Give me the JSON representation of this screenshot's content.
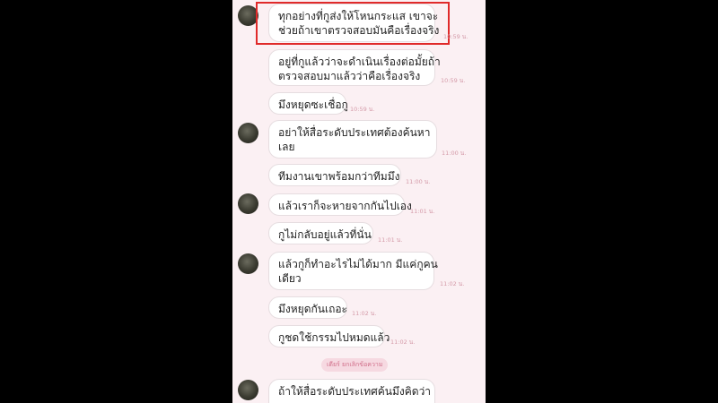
{
  "messages": [
    {
      "lines": [
        "ทุกอย่างที่กูส่งให้โหนกระแส เขาจะ",
        "ช่วยถ้าเขาตรวจสอบมันคือเรื่องจริง"
      ],
      "time": "10:59 น."
    },
    {
      "lines": [
        "อยู่ที่กูแล้วว่าจะดำเนินเรื่องต่อมั้ยถ้า",
        "ตรวจสอบมาแล้วว่าคือเรื่องจริง"
      ],
      "time": "10:59 น."
    },
    {
      "lines": [
        "มึงหยุดซะเชื่อกู"
      ],
      "time": "10:59 น."
    },
    {
      "lines": [
        "อย่าให้สื่อระดับประเทศต้องค้นหา",
        "เลย"
      ],
      "time": "11:00 น."
    },
    {
      "lines": [
        "ทีมงานเขาพร้อมกว่าทีมมึง"
      ],
      "time": "11:00 น."
    },
    {
      "lines": [
        "แล้วเราก็จะหายจากกันไปเอง"
      ],
      "time": "11:01 น."
    },
    {
      "lines": [
        "กูไม่กลับอยู่แล้วที่นั่น"
      ],
      "time": "11:01 น."
    },
    {
      "lines": [
        "แล้วกูก็ทำอะไรไม่ได้มาก มีแค่กูคน",
        "เดียว"
      ],
      "time": "11:02 น."
    },
    {
      "lines": [
        "มึงหยุดกันเถอะ"
      ],
      "time": "11:02 น."
    },
    {
      "lines": [
        "กูชดใช้กรรมไปหมดแล้ว"
      ],
      "time": "11:02 น."
    },
    {
      "lines": [
        "ถ้าให้สื่อระดับประเทศค้นมึงคิดว่า",
        "..."
      ],
      "time": ""
    }
  ],
  "system_notice": "เดียร์ ยกเลิกข้อความ",
  "colors": {
    "screen_bg": "#fbf0f3",
    "highlight": "#e02a2a",
    "time": "#d49aa8"
  }
}
